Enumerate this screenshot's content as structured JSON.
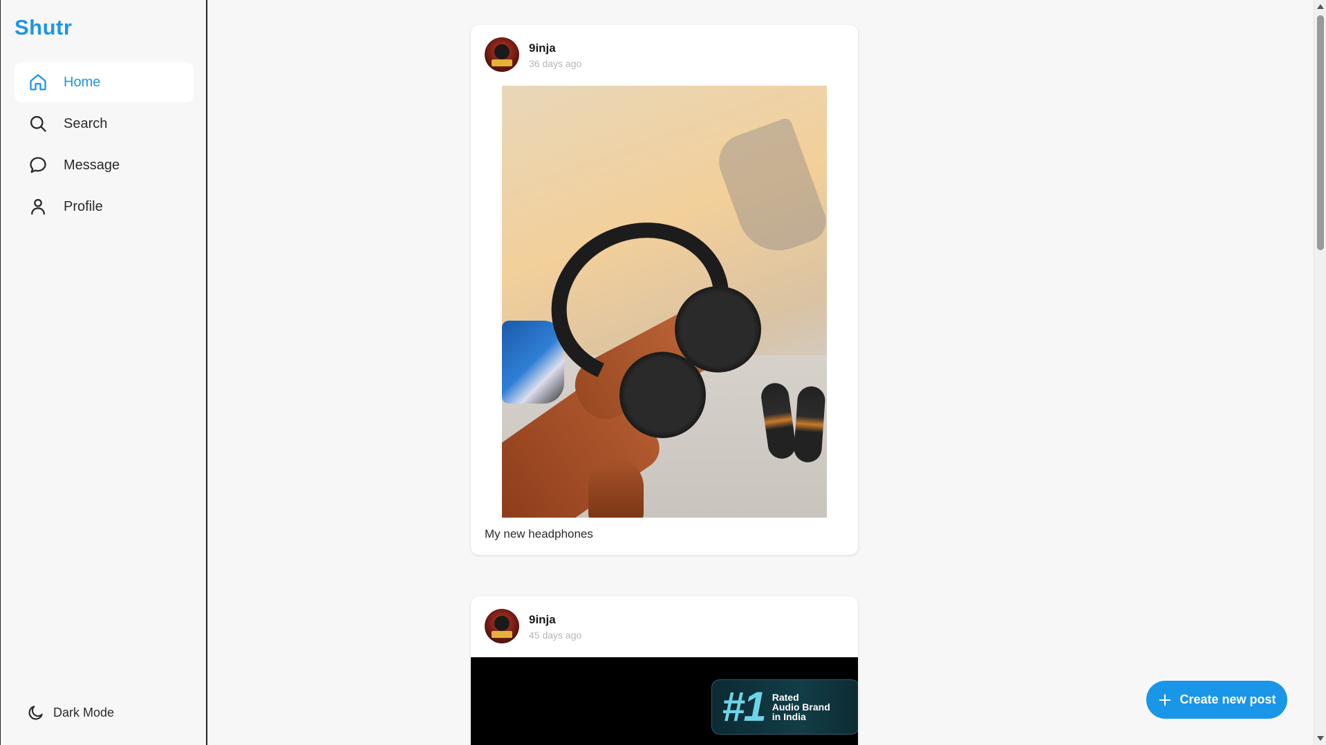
{
  "app": {
    "brand": "Shutr",
    "accent_color": "#1a96e8"
  },
  "sidebar": {
    "items": [
      {
        "label": "Home",
        "icon": "home-icon",
        "active": true
      },
      {
        "label": "Search",
        "icon": "search-icon",
        "active": false
      },
      {
        "label": "Message",
        "icon": "message-icon",
        "active": false
      },
      {
        "label": "Profile",
        "icon": "user-icon",
        "active": false
      }
    ],
    "dark_mode_label": "Dark Mode"
  },
  "feed": {
    "posts": [
      {
        "username": "9inja",
        "time": "36 days ago",
        "caption": "My new headphones",
        "image": "photo of hand holding black headphones"
      },
      {
        "username": "9inja",
        "time": "45 days ago",
        "banner_number": "#1",
        "banner_text_1": "Rated",
        "banner_text_2": "Audio Brand",
        "banner_text_3": "in India"
      }
    ]
  },
  "fab": {
    "label": "Create new post",
    "icon": "plus-icon"
  }
}
